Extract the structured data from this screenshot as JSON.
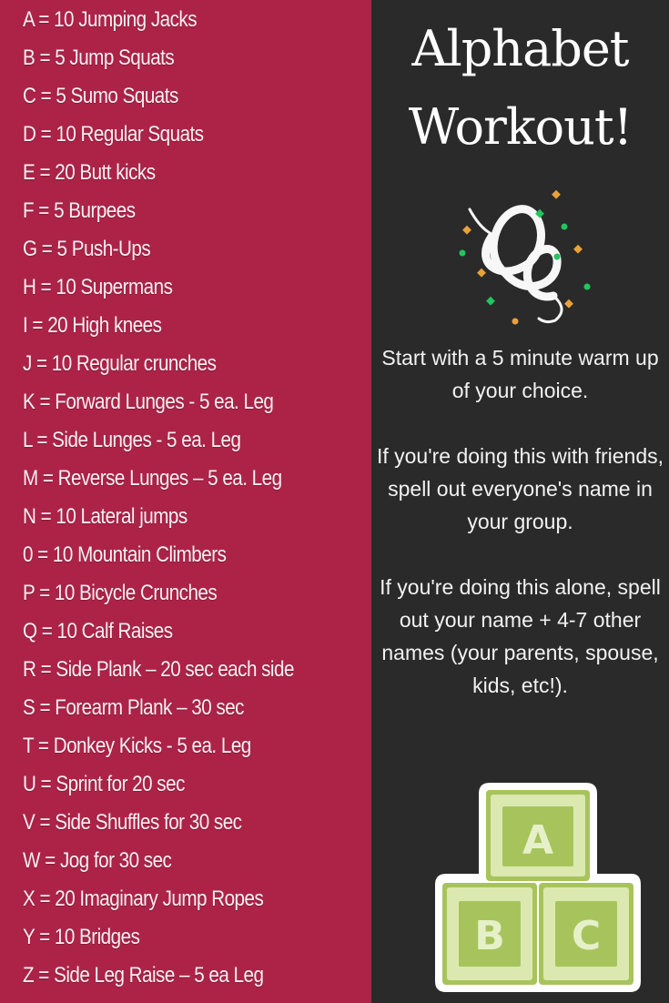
{
  "colors": {
    "left_bg": "#ad2348",
    "right_bg": "#2a2a2a",
    "block_light": "#dbe9b0",
    "block_dark": "#a7c45c",
    "confetti_green": "#22c55e",
    "confetti_orange": "#e8a23a"
  },
  "exercises": [
    "A = 10 Jumping Jacks",
    "B = 5 Jump Squats",
    "C = 5 Sumo Squats",
    "D = 10 Regular Squats",
    "E = 20 Butt kicks",
    "F = 5 Burpees",
    "G = 5 Push-Ups",
    "H = 10 Supermans",
    "I = 20 High knees",
    "J = 10 Regular crunches",
    "K = Forward Lunges - 5 ea. Leg",
    "L = Side Lunges - 5 ea. Leg",
    "M = Reverse Lunges – 5 ea. Leg",
    "N = 10 Lateral jumps",
    "0 = 10 Mountain Climbers",
    "P = 10 Bicycle Crunches",
    "Q = 10 Calf Raises",
    "R = Side Plank – 20 sec each side",
    "S = Forearm Plank – 30 sec",
    "T = Donkey Kicks - 5 ea. Leg",
    "U = Sprint for 20 sec",
    "V = Side Shuffles for 30 sec",
    "W = Jog for 30 sec",
    "X = 20 Imaginary Jump Ropes",
    "Y = 10 Bridges",
    "Z = Side Leg Raise – 5 ea Leg"
  ],
  "title": {
    "line1": "Alphabet",
    "line2": "Workout!"
  },
  "icons": {
    "confetti": "confetti-streamer-icon",
    "blocks": "abc-blocks-icon"
  },
  "instructions": [
    "Start with a 5 minute warm up of your choice.",
    "If you're doing this with friends, spell out everyone's name in your group.",
    "If you're doing this alone, spell out your name + 4-7 other names (your parents, spouse, kids, etc!)."
  ],
  "blocks": {
    "top": "A",
    "bottom_left": "B",
    "bottom_right": "C"
  }
}
